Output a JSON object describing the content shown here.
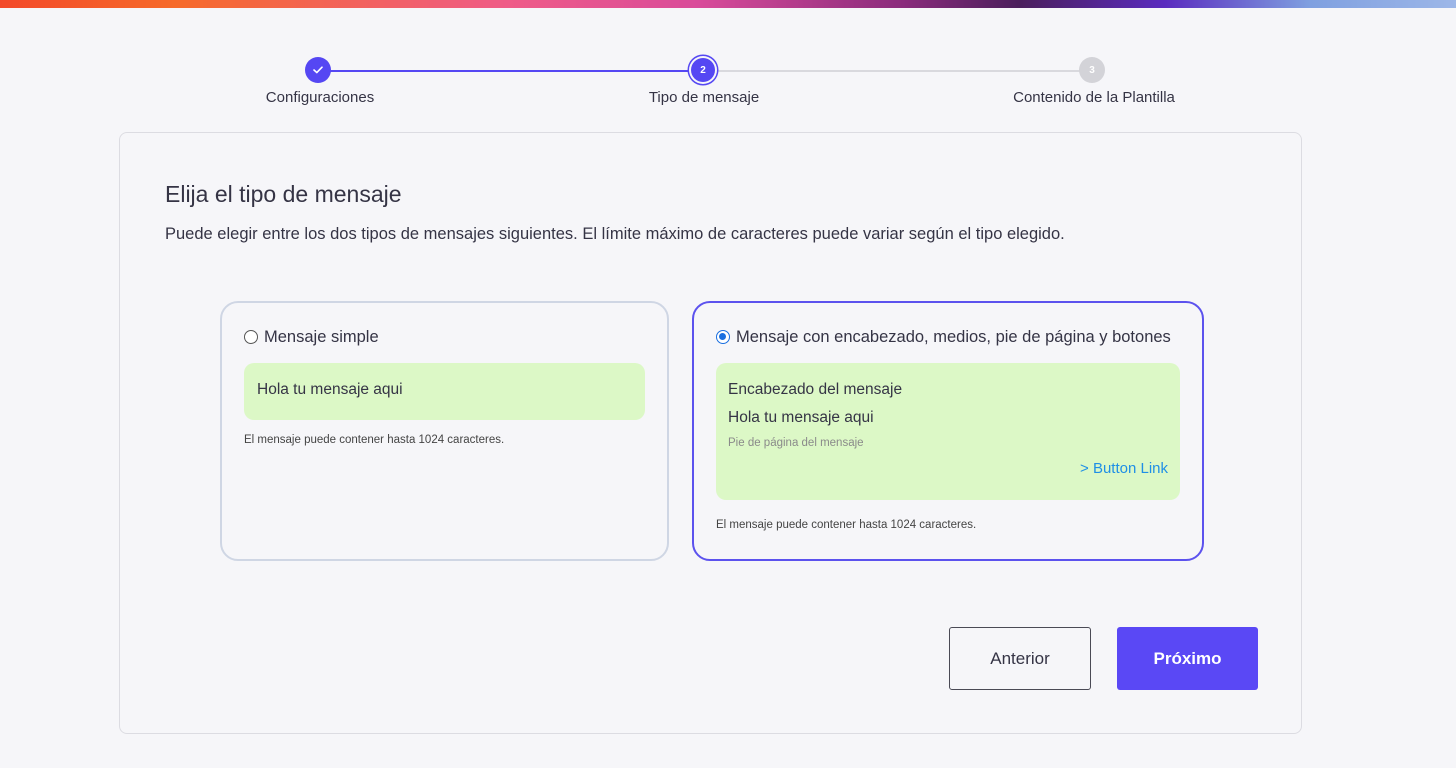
{
  "stepper": {
    "steps": [
      {
        "label": "Configuraciones",
        "number": "1",
        "status": "completed"
      },
      {
        "label": "Tipo de mensaje",
        "number": "2",
        "status": "active"
      },
      {
        "label": "Contenido de la Plantilla",
        "number": "3",
        "status": "pending"
      }
    ]
  },
  "card": {
    "title": "Elija el tipo de mensaje",
    "description": "Puede elegir entre los dos tipos de mensajes siguientes. El límite máximo de caracteres puede variar según el tipo elegido."
  },
  "options": {
    "simple": {
      "label": "Mensaje simple",
      "selected": false,
      "preview_body": "Hola tu mensaje aqui",
      "hint": "El mensaje puede contener hasta 1024 caracteres."
    },
    "rich": {
      "label": "Mensaje con encabezado, medios, pie de página y botones",
      "selected": true,
      "preview_header": "Encabezado del mensaje",
      "preview_body": "Hola tu mensaje aqui",
      "preview_footer": "Pie de página del mensaje",
      "preview_button": "> Button Link",
      "hint": "El mensaje puede contener hasta 1024 caracteres."
    }
  },
  "actions": {
    "previous_label": "Anterior",
    "next_label": "Próximo"
  },
  "colors": {
    "accent": "#5547f3",
    "bubble": "#dcf8c6",
    "link": "#1f8fe6"
  }
}
